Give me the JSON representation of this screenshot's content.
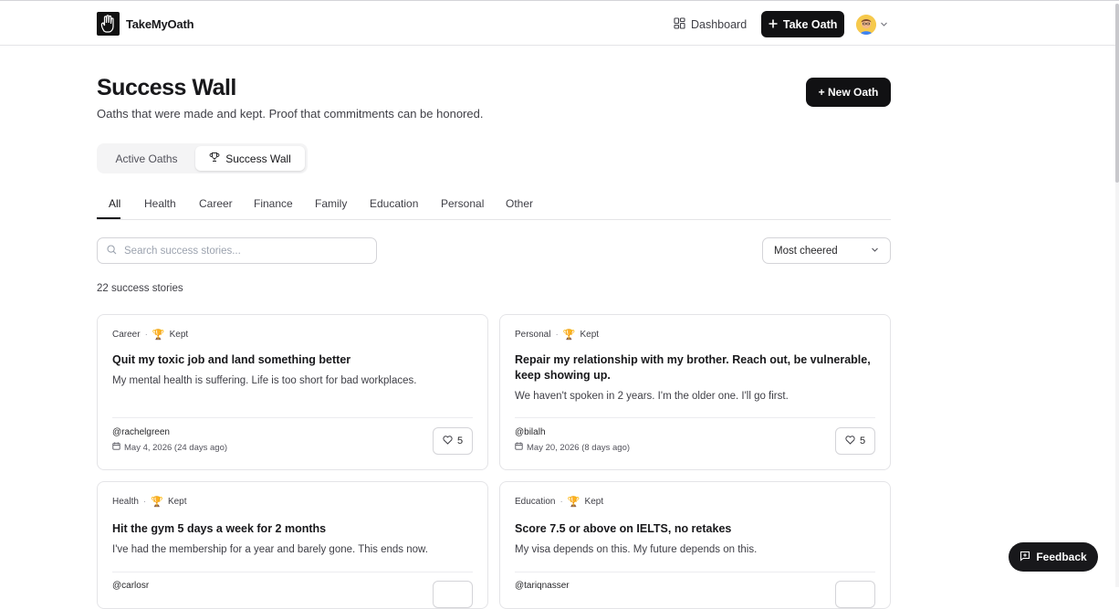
{
  "nav": {
    "brand": "TakeMyOath",
    "dashboard": "Dashboard",
    "take_oath": "Take Oath"
  },
  "page": {
    "title": "Success Wall",
    "subtitle": "Oaths that were made and kept. Proof that commitments can be honored.",
    "new_oath": "+ New Oath"
  },
  "tabs": {
    "active_oaths": "Active Oaths",
    "success_wall": "Success Wall"
  },
  "categories": [
    "All",
    "Health",
    "Career",
    "Finance",
    "Family",
    "Education",
    "Personal",
    "Other"
  ],
  "search": {
    "placeholder": "Search success stories..."
  },
  "sort": {
    "selected": "Most cheered"
  },
  "count": "22 success stories",
  "cards": [
    {
      "category": "Career",
      "status": "Kept",
      "title": "Quit my toxic job and land something better",
      "description": "My mental health is suffering. Life is too short for bad workplaces.",
      "handle": "@rachelgreen",
      "date": "May 4, 2026 (24 days ago)",
      "cheers": "5"
    },
    {
      "category": "Personal",
      "status": "Kept",
      "title": "Repair my relationship with my brother. Reach out, be vulnerable, keep showing up.",
      "description": "We haven't spoken in 2 years. I'm the older one. I'll go first.",
      "handle": "@bilalh",
      "date": "May 20, 2026 (8 days ago)",
      "cheers": "5"
    },
    {
      "category": "Health",
      "status": "Kept",
      "title": "Hit the gym 5 days a week for 2 months",
      "description": "I've had the membership for a year and barely gone. This ends now.",
      "handle": "@carlosr",
      "date": "",
      "cheers": ""
    },
    {
      "category": "Education",
      "status": "Kept",
      "title": "Score 7.5 or above on IELTS, no retakes",
      "description": "My visa depends on this. My future depends on this.",
      "handle": "@tariqnasser",
      "date": "",
      "cheers": ""
    }
  ],
  "feedback": "Feedback",
  "colors": {
    "primary": "#111113",
    "border": "#e4e4e7",
    "muted_text": "#3f3f46"
  },
  "icons": [
    "hand-logo-icon",
    "grid-icon",
    "plus-icon",
    "chevron-down-icon",
    "trophy-icon",
    "search-icon",
    "calendar-icon",
    "heart-icon",
    "message-plus-icon"
  ]
}
